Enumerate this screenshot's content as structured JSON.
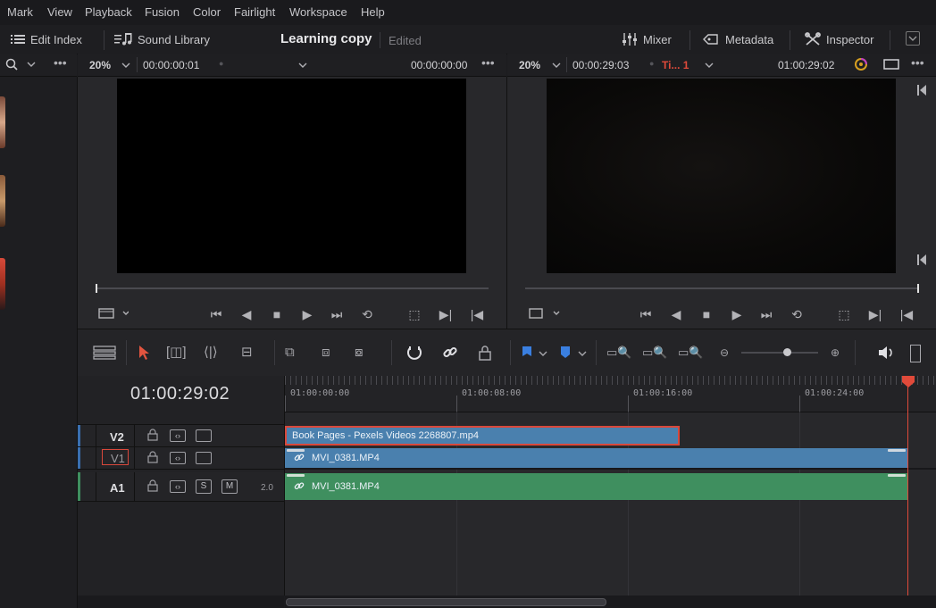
{
  "menu": [
    "Mark",
    "View",
    "Playback",
    "Fusion",
    "Color",
    "Fairlight",
    "Workspace",
    "Help"
  ],
  "topbar": {
    "edit_index": "Edit Index",
    "sound_library": "Sound Library",
    "project_title": "Learning copy",
    "status": "Edited",
    "mixer": "Mixer",
    "metadata": "Metadata",
    "inspector": "Inspector"
  },
  "source_viewer": {
    "zoom": "20%",
    "duration": "00:00:00:01",
    "timecode": "00:00:00:00"
  },
  "timeline_viewer": {
    "zoom": "20%",
    "duration": "00:00:29:03",
    "timeline_name": "Ti... 1",
    "timecode": "01:00:29:02"
  },
  "timeline": {
    "current_timecode": "01:00:29:02",
    "ruler": [
      "01:00:00:00",
      "01:00:08:00",
      "01:00:16:00",
      "01:00:24:00"
    ],
    "tracks": {
      "v2": {
        "name": "V2"
      },
      "v1": {
        "name": "V1"
      },
      "a1": {
        "name": "A1",
        "solo": "S",
        "mute": "M",
        "channels": "2.0"
      }
    },
    "clips": {
      "v2_clip": "Book Pages - Pexels Videos 2268807.mp4",
      "v1_clip": "MVI_0381.MP4",
      "a1_clip": "MVI_0381.MP4"
    }
  },
  "colors": {
    "video_clip": "#4a80ae",
    "audio_clip": "#3f8f5f",
    "playhead": "#e04a3a",
    "selection": "#d9483b"
  }
}
